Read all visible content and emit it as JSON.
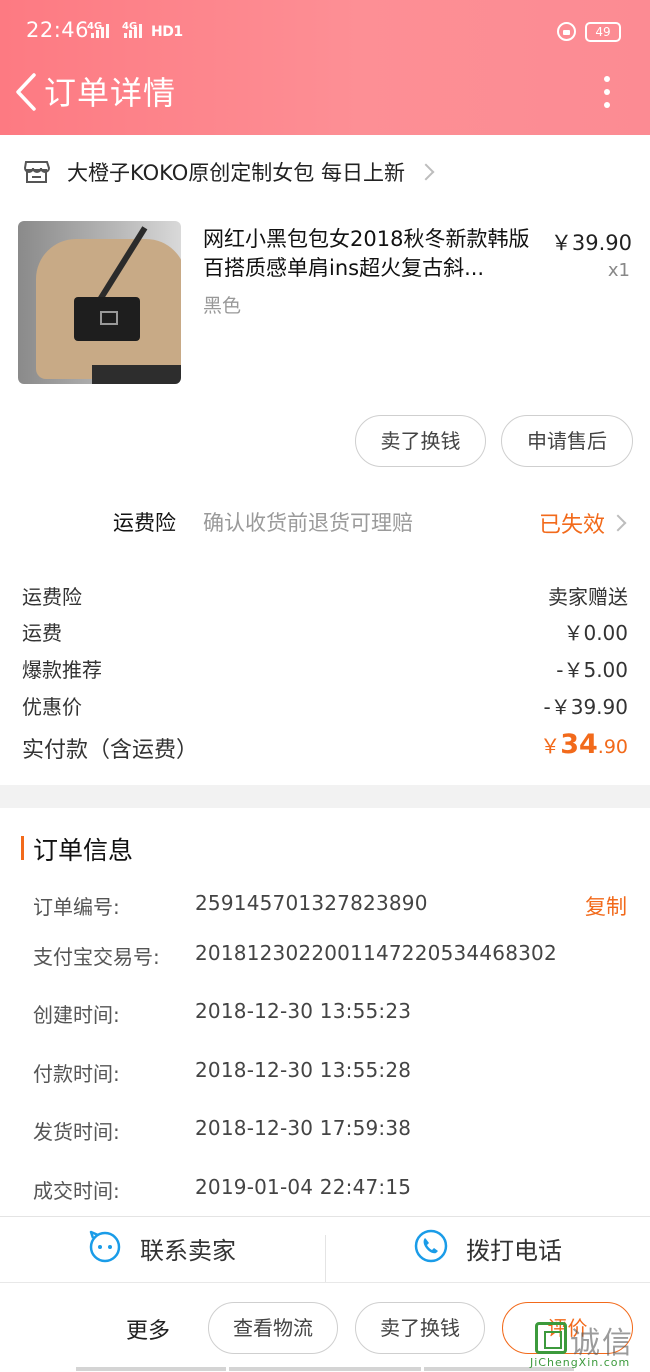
{
  "status_bar": {
    "time": "22:46",
    "network_1": "4G",
    "network_2": "4G",
    "hd": "HD1",
    "battery": "49"
  },
  "header": {
    "title": "订单详情",
    "back_icon": "chevron-left-icon",
    "more_icon": "more-vertical-icon"
  },
  "shop": {
    "name": "大橙子KOKO原创定制女包 每日上新",
    "icon": "store-icon"
  },
  "product": {
    "title": "网红小黑包包女2018秋冬新款韩版百搭质感单肩ins超火复古斜...",
    "price": "￥39.90",
    "quantity": "x1",
    "spec": "黑色"
  },
  "product_actions": {
    "sell_exchange": "卖了换钱",
    "after_sale": "申请售后"
  },
  "insurance": {
    "label": "运费险",
    "description": "确认收货前退货可理赔",
    "status": "已失效"
  },
  "fees": [
    {
      "label": "运费险",
      "value": "卖家赠送"
    },
    {
      "label": "运费",
      "value": "￥0.00"
    },
    {
      "label": "爆款推荐",
      "value": "-￥5.00"
    },
    {
      "label": "优惠价",
      "value": "-￥39.90"
    }
  ],
  "paid": {
    "label": "实付款（含运费）",
    "currency": "￥",
    "integer": "34",
    "decimal": ".90"
  },
  "order_info": {
    "title": "订单信息",
    "copy_label": "复制",
    "rows": [
      {
        "key": "订单编号:",
        "value": "259145701327823890"
      },
      {
        "key": "支付宝交易号:",
        "value": "2018123022001147220534468302"
      },
      {
        "key": "创建时间:",
        "value": "2018-12-30 13:55:23"
      },
      {
        "key": "付款时间:",
        "value": "2018-12-30 13:55:28"
      },
      {
        "key": "发货时间:",
        "value": "2018-12-30 17:59:38"
      },
      {
        "key": "成交时间:",
        "value": "2019-01-04 22:47:15"
      }
    ]
  },
  "contact": {
    "seller_label": "联系卖家",
    "seller_icon": "chat-face-icon",
    "phone_label": "拨打电话",
    "phone_icon": "phone-icon"
  },
  "bottom_actions": {
    "more": "更多",
    "logistics": "查看物流",
    "sell_exchange": "卖了换钱",
    "review": "评价"
  },
  "watermark": {
    "cn": "诚信",
    "en": "JiChengXin.com"
  },
  "colors": {
    "header_bg": "#fd8a91",
    "accent_orange": "#f26a1b",
    "contact_blue": "#1a9ce8"
  }
}
